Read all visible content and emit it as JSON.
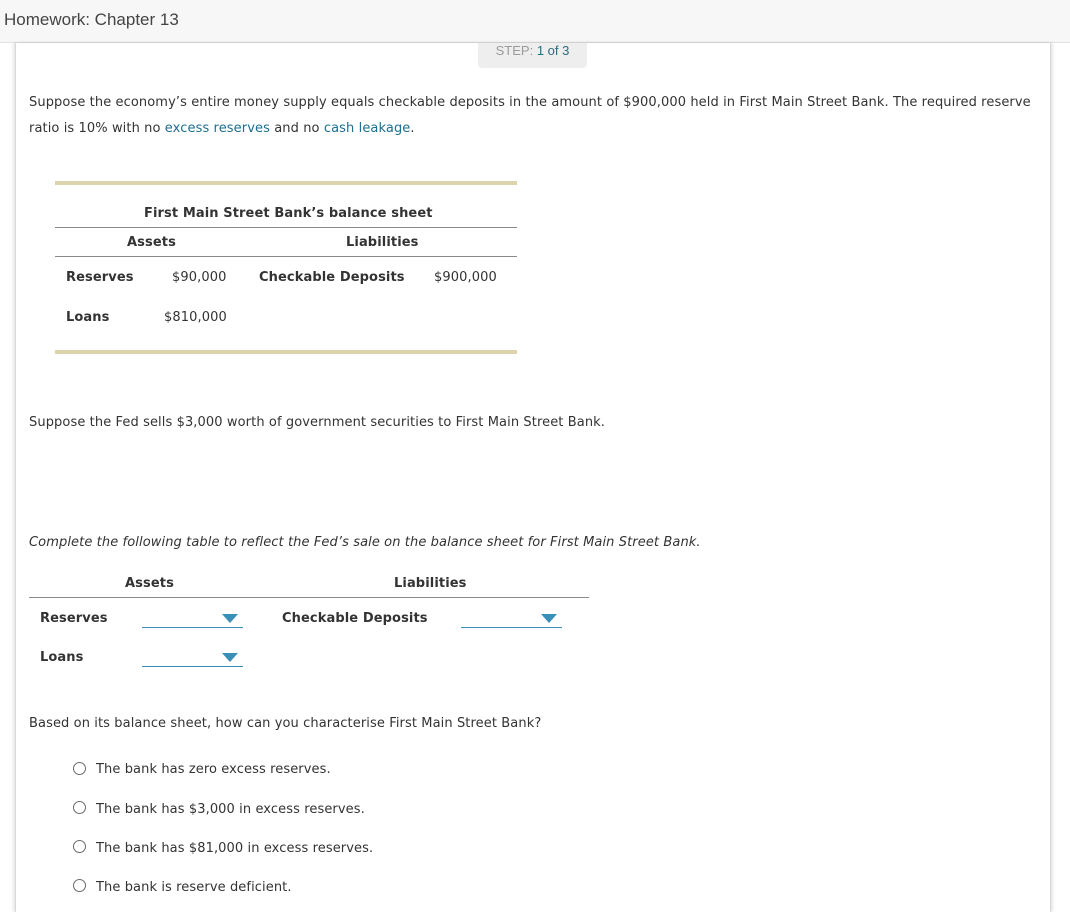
{
  "header": {
    "title": "Homework: Chapter 13"
  },
  "step": {
    "label": "STEP: ",
    "current": "1 of 3"
  },
  "intro": {
    "line1": "Suppose the economy’s entire money supply equals checkable deposits in the amount of $900,000 held in First Main Street Bank. The required reserve",
    "line2_prefix": "ratio is 10% with no ",
    "link1": "excess reserves",
    "line2_mid": " and no ",
    "link2": "cash leakage",
    "line2_suffix": "."
  },
  "balance_sheet": {
    "title": "First Main Street Bank’s balance sheet",
    "assets_header": "Assets",
    "liabilities_header": "Liabilities",
    "rows": [
      {
        "asset_label": "Reserves",
        "asset_value": "$90,000",
        "liability_label": "Checkable Deposits",
        "liability_value": "$900,000"
      },
      {
        "asset_label": "Loans",
        "asset_value": "$810,000",
        "liability_label": "",
        "liability_value": ""
      }
    ]
  },
  "fed_sale_text": "Suppose the Fed sells $3,000 worth of government securities to First Main Street Bank.",
  "instruction": "Complete the following table to reflect the Fed’s sale on the balance sheet for First Main Street Bank.",
  "answer_table": {
    "assets_header": "Assets",
    "liabilities_header": "Liabilities",
    "reserves_label": "Reserves",
    "loans_label": "Loans",
    "deposits_label": "Checkable Deposits",
    "reserves_value": "",
    "loans_value": "",
    "deposits_value": ""
  },
  "question": "Based on its balance sheet, how can you characterise First Main Street Bank?",
  "options": [
    "The bank has zero excess reserves.",
    "The bank has $3,000 in excess reserves.",
    "The bank has $81,000 in excess reserves.",
    "The bank is reserve deficient."
  ],
  "colors": {
    "link": "#1d6e90",
    "dropdown_accent": "#3a8fb8",
    "table_rule": "#ddd3ad",
    "step_number": "#2b6c82"
  }
}
